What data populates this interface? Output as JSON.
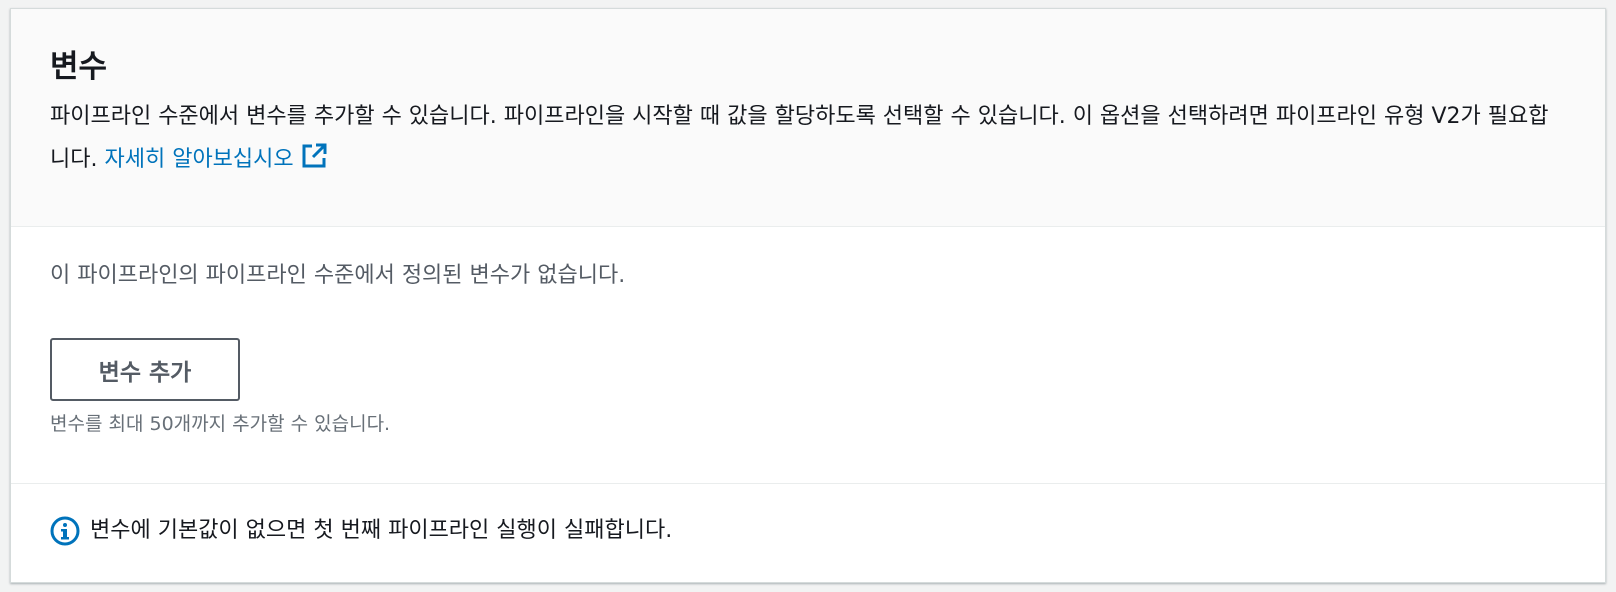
{
  "section": {
    "title": "변수",
    "description": "파이프라인 수준에서 변수를 추가할 수 있습니다. 파이프라인을 시작할 때 값을 할당하도록 선택할 수 있습니다. 이 옵션을 선택하려면 파이프라인 유형 V2가 필요합니다.",
    "learn_more_label": "자세히 알아보십시오",
    "learn_more_icon": "external-link-icon"
  },
  "body": {
    "empty_message": "이 파이프라인의 파이프라인 수준에서 정의된 변수가 없습니다.",
    "add_button_label": "변수 추가",
    "limit_hint": "변수를 최대 50개까지 추가할 수 있습니다."
  },
  "footer": {
    "info_icon": "info-icon",
    "info_message": "변수에 기본값이 없으면 첫 번째 파이프라인 실행이 실패합니다."
  },
  "colors": {
    "link": "#0073bb",
    "text": "#16191f",
    "secondary_text": "#545b64"
  }
}
